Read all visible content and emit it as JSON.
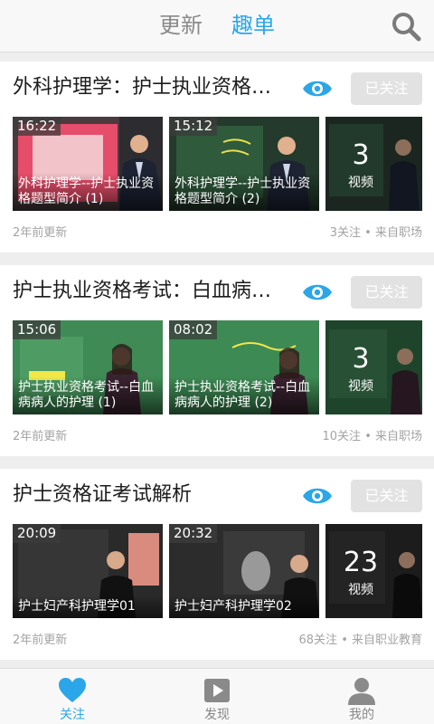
{
  "header": {
    "tab_updates": "更新",
    "tab_lists": "趣单",
    "active_tab": "趣单",
    "accent": "#2ba6e8"
  },
  "cards": [
    {
      "title": "外科护理学：护士执业资格考试",
      "follow_label": "已关注",
      "thumbs": [
        {
          "duration": "16:22",
          "caption": "外科护理学--护士执业资格题型简介 (1)"
        },
        {
          "duration": "15:12",
          "caption": "外科护理学--护士执业资格题型简介 (2)"
        }
      ],
      "video_count": "3",
      "video_label": "视频",
      "time": "2年前更新",
      "meta": "3关注 • 来自职场"
    },
    {
      "title": "护士执业资格考试：白血病病人的护理",
      "follow_label": "已关注",
      "thumbs": [
        {
          "duration": "15:06",
          "caption": "护士执业资格考试--白血病病人的护理 (1)"
        },
        {
          "duration": "08:02",
          "caption": "护士执业资格考试--白血病病人的护理 (2)"
        }
      ],
      "video_count": "3",
      "video_label": "视频",
      "time": "2年前更新",
      "meta": "10关注 • 来自职场"
    },
    {
      "title": "护士资格证考试解析",
      "follow_label": "已关注",
      "thumbs": [
        {
          "duration": "20:09",
          "caption": "护士妇产科护理学01"
        },
        {
          "duration": "20:32",
          "caption": "护士妇产科护理学02"
        }
      ],
      "video_count": "23",
      "video_label": "视频",
      "time": "2年前更新",
      "meta": "68关注 • 来自职业教育"
    }
  ],
  "bottom_nav": [
    {
      "label": "关注",
      "icon": "heart-icon",
      "active": true
    },
    {
      "label": "发现",
      "icon": "play-icon",
      "active": false
    },
    {
      "label": "我的",
      "icon": "person-icon",
      "active": false
    }
  ]
}
